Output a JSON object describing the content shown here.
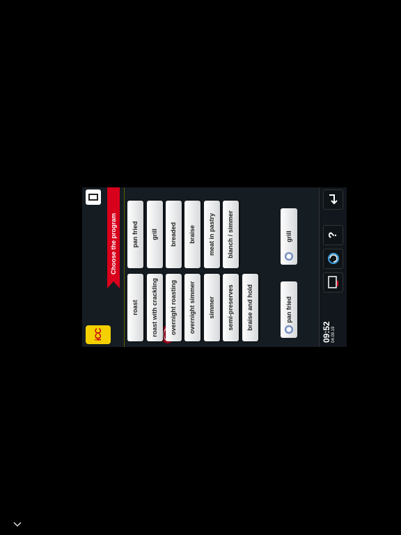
{
  "header": {
    "logo_text": "iCC",
    "title": "Choose the program"
  },
  "programs": {
    "left": [
      "roast",
      "roast with crackling",
      "overnight roasting",
      "overnight simmer",
      "simmer",
      "semi-preserves",
      "braise and hold"
    ],
    "right": [
      "pan fried",
      "grill",
      "breaded",
      "braise",
      "meat in pastry",
      "blanch / simmer"
    ]
  },
  "favorites": [
    "pan fried",
    "grill"
  ],
  "footer": {
    "time": "09:52",
    "date": "04.09.19",
    "icons": [
      "cooking-monitor-icon",
      "clean-care-icon",
      "help-icon",
      "back-icon"
    ]
  },
  "colors": {
    "accent": "#d9001b",
    "logo": "#f4d000",
    "background": "#151c22"
  }
}
